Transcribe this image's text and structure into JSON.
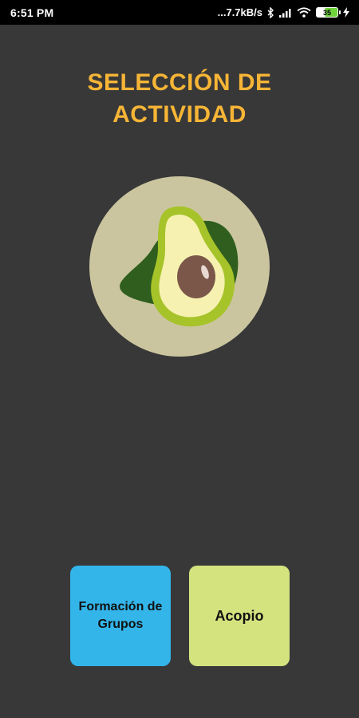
{
  "status_bar": {
    "time": "6:51 PM",
    "network_speed": "...7.7kB/s",
    "battery_level": "35",
    "icons": [
      "bluetooth-icon",
      "signal-icon",
      "wifi-icon",
      "battery-icon",
      "charging-icon"
    ]
  },
  "header": {
    "title_line1": "SELECCIÓN DE",
    "title_line2": "ACTIVIDAD",
    "title_color": "#f7b536"
  },
  "logo": {
    "icon": "avocado-icon"
  },
  "actions": {
    "groups_label": "Formación de Grupos",
    "acopio_label": "Acopio",
    "groups_color": "#33b5ea",
    "acopio_color": "#d5e37f"
  },
  "colors": {
    "background": "#383838"
  }
}
